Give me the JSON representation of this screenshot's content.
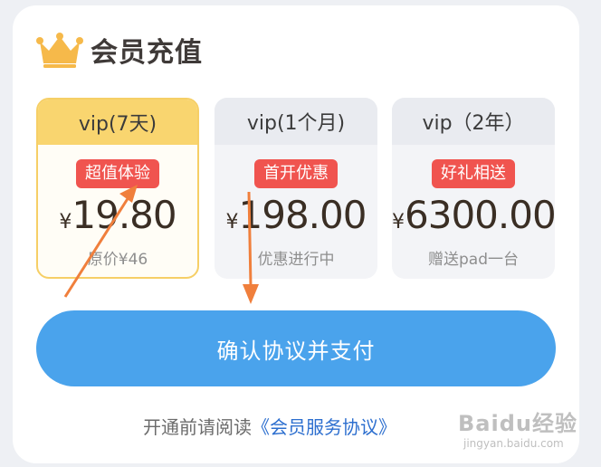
{
  "header": {
    "title": "会员充值",
    "icon": "crown-icon"
  },
  "plans": [
    {
      "name": "vip(7天)",
      "badge": "超值体验",
      "currency": "¥",
      "price": "19.80",
      "note": "原价¥46",
      "selected": true
    },
    {
      "name": "vip(1个月)",
      "badge": "首开优惠",
      "currency": "¥",
      "price": "198.00",
      "note": "优惠进行中",
      "selected": false
    },
    {
      "name": "vip（2年）",
      "badge": "好礼相送",
      "currency": "¥",
      "price": "6300.00",
      "note": "赠送pad一台",
      "selected": false
    }
  ],
  "pay_button": {
    "label": "确认协议并支付"
  },
  "agreement": {
    "prefix": "开通前请阅读",
    "link": "《会员服务协议》"
  },
  "watermark": {
    "main": "Baidu经验",
    "sub": "jingyan.baidu.com"
  },
  "colors": {
    "accent": "#4aa3ec",
    "badge": "#f0544f",
    "selected_head": "#f9d56f",
    "annotation_arrow": "#f07f3c"
  }
}
